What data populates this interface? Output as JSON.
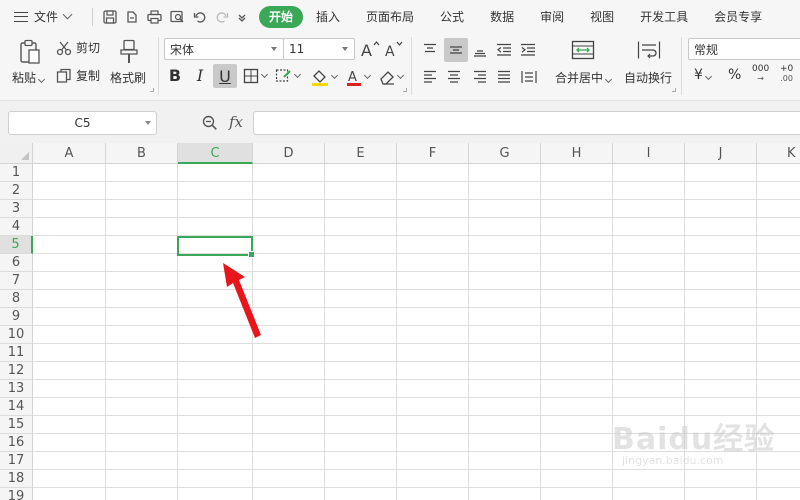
{
  "menubar": {
    "file_label": "文件",
    "tabs": [
      "开始",
      "插入",
      "页面布局",
      "公式",
      "数据",
      "审阅",
      "视图",
      "开发工具",
      "会员专享"
    ],
    "active_tab": "开始"
  },
  "ribbon": {
    "paste_label": "粘贴",
    "cut_label": "剪切",
    "copy_label": "复制",
    "format_painter_label": "格式刷",
    "font_name": "宋体",
    "font_size": "11",
    "merge_center_label": "合并居中",
    "wrap_text_label": "自动换行",
    "number_format": "常规",
    "bold_label": "B",
    "italic_label": "I",
    "underline_label": "U",
    "currency_symbol": "¥",
    "percent_symbol": "%",
    "thousands_symbol": "000"
  },
  "formula_bar": {
    "name_box": "C5",
    "fx_label": "fx",
    "formula": ""
  },
  "sheet": {
    "columns": [
      "A",
      "B",
      "C",
      "D",
      "E",
      "F",
      "G",
      "H",
      "I",
      "J",
      "K"
    ],
    "rows": [
      "1",
      "2",
      "3",
      "4",
      "5",
      "6",
      "7",
      "8",
      "9",
      "10",
      "11",
      "12",
      "13",
      "14",
      "15",
      "16",
      "17",
      "18",
      "19"
    ],
    "selected_column": "C",
    "selected_row": "5"
  },
  "colors": {
    "accent": "#3aa856",
    "annotation_arrow": "#e8161b"
  },
  "watermark": {
    "brand": "Baidu经验",
    "url": "jingyan.baidu.com"
  }
}
